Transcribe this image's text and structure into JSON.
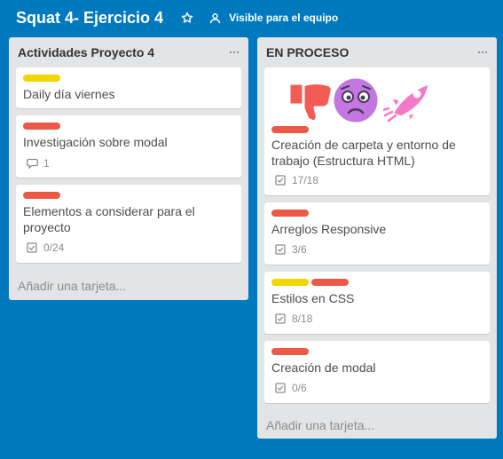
{
  "board": {
    "title": "Squat 4- Ejercicio 4",
    "visibility_label": "Visible para el equipo"
  },
  "lists": [
    {
      "title": "Actividades Proyecto 4",
      "add_card_label": "Añadir una tarjeta...",
      "cards": [
        {
          "labels": [
            "yellow"
          ],
          "title": "Daily día viernes"
        },
        {
          "labels": [
            "red"
          ],
          "title": "Investigación sobre modal",
          "comments": "1"
        },
        {
          "labels": [
            "red"
          ],
          "title": "Elementos a considerar para el proyecto",
          "checklist": "0/24"
        }
      ]
    },
    {
      "title": "EN PROCESO",
      "add_card_label": "Añadir una tarjeta...",
      "cards": [
        {
          "stickers": [
            "thumbs-down-sticker",
            "worried-face-sticker",
            "rocket-sticker"
          ],
          "labels": [
            "red"
          ],
          "title": "Creación de carpeta y entorno de trabajo (Estructura HTML)",
          "checklist": "17/18"
        },
        {
          "labels": [
            "red"
          ],
          "title": "Arreglos Responsive",
          "checklist": "3/6"
        },
        {
          "labels": [
            "yellow",
            "red"
          ],
          "title": "Estilos en CSS",
          "checklist": "8/18"
        },
        {
          "labels": [
            "red"
          ],
          "title": "Creación de modal",
          "checklist": "0/6"
        }
      ]
    }
  ],
  "colors": {
    "background": "#0079bf",
    "list": "#e2e4e6",
    "label_yellow": "#f2d600",
    "label_red": "#eb5a46"
  }
}
